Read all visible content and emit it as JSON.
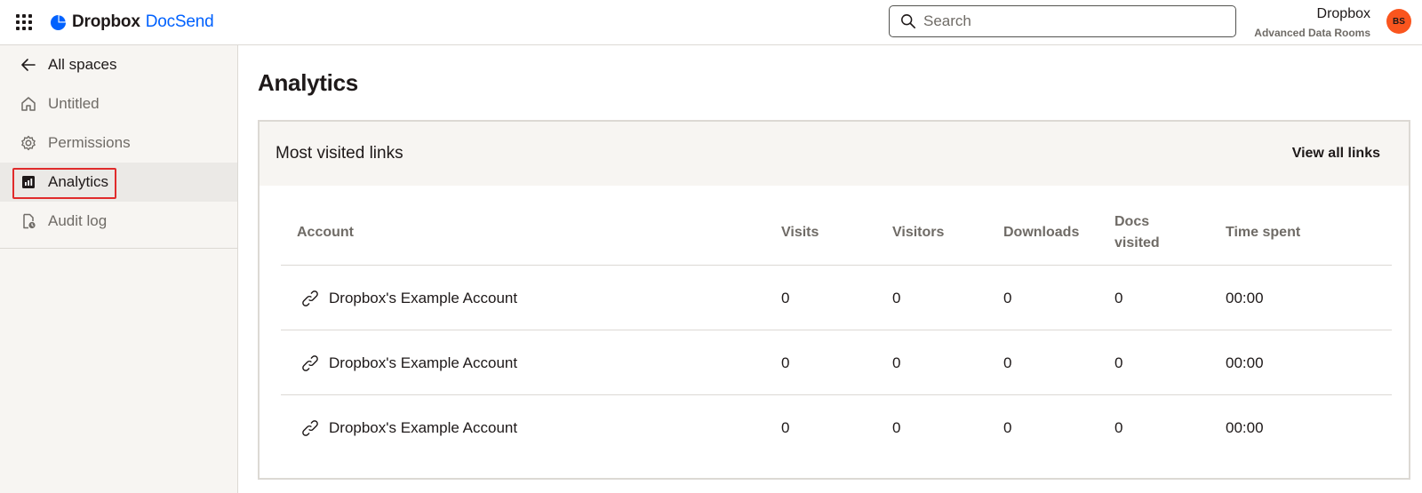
{
  "topbar": {
    "apps_icon": "app-grid-icon",
    "logo_primary": "Dropbox",
    "logo_secondary": "DocSend",
    "search_placeholder": "Search",
    "account_name": "Dropbox",
    "account_subtitle": "Advanced Data Rooms",
    "avatar_initials": "BS",
    "avatar_color": "#fa551e",
    "brand_color": "#0061fe"
  },
  "sidebar": {
    "items": [
      {
        "label": "All spaces",
        "icon": "arrow-left-icon"
      },
      {
        "label": "Untitled",
        "icon": "home-icon"
      },
      {
        "label": "Permissions",
        "icon": "gear-icon"
      },
      {
        "label": "Analytics",
        "icon": "bar-chart-icon"
      },
      {
        "label": "Audit log",
        "icon": "audit-log-icon"
      }
    ],
    "active_index": 3,
    "highlight_color": "#e02b2b"
  },
  "main": {
    "title": "Analytics",
    "card": {
      "title": "Most visited links",
      "view_all_label": "View all links",
      "columns": [
        "Account",
        "Visits",
        "Visitors",
        "Downloads",
        "Docs visited",
        "Time spent"
      ],
      "rows": [
        {
          "account": "Dropbox's Example Account",
          "visits": "0",
          "visitors": "0",
          "downloads": "0",
          "docs_visited": "0",
          "time_spent": "00:00"
        },
        {
          "account": "Dropbox's Example Account",
          "visits": "0",
          "visitors": "0",
          "downloads": "0",
          "docs_visited": "0",
          "time_spent": "00:00"
        },
        {
          "account": "Dropbox's Example Account",
          "visits": "0",
          "visitors": "0",
          "downloads": "0",
          "docs_visited": "0",
          "time_spent": "00:00"
        }
      ]
    }
  }
}
